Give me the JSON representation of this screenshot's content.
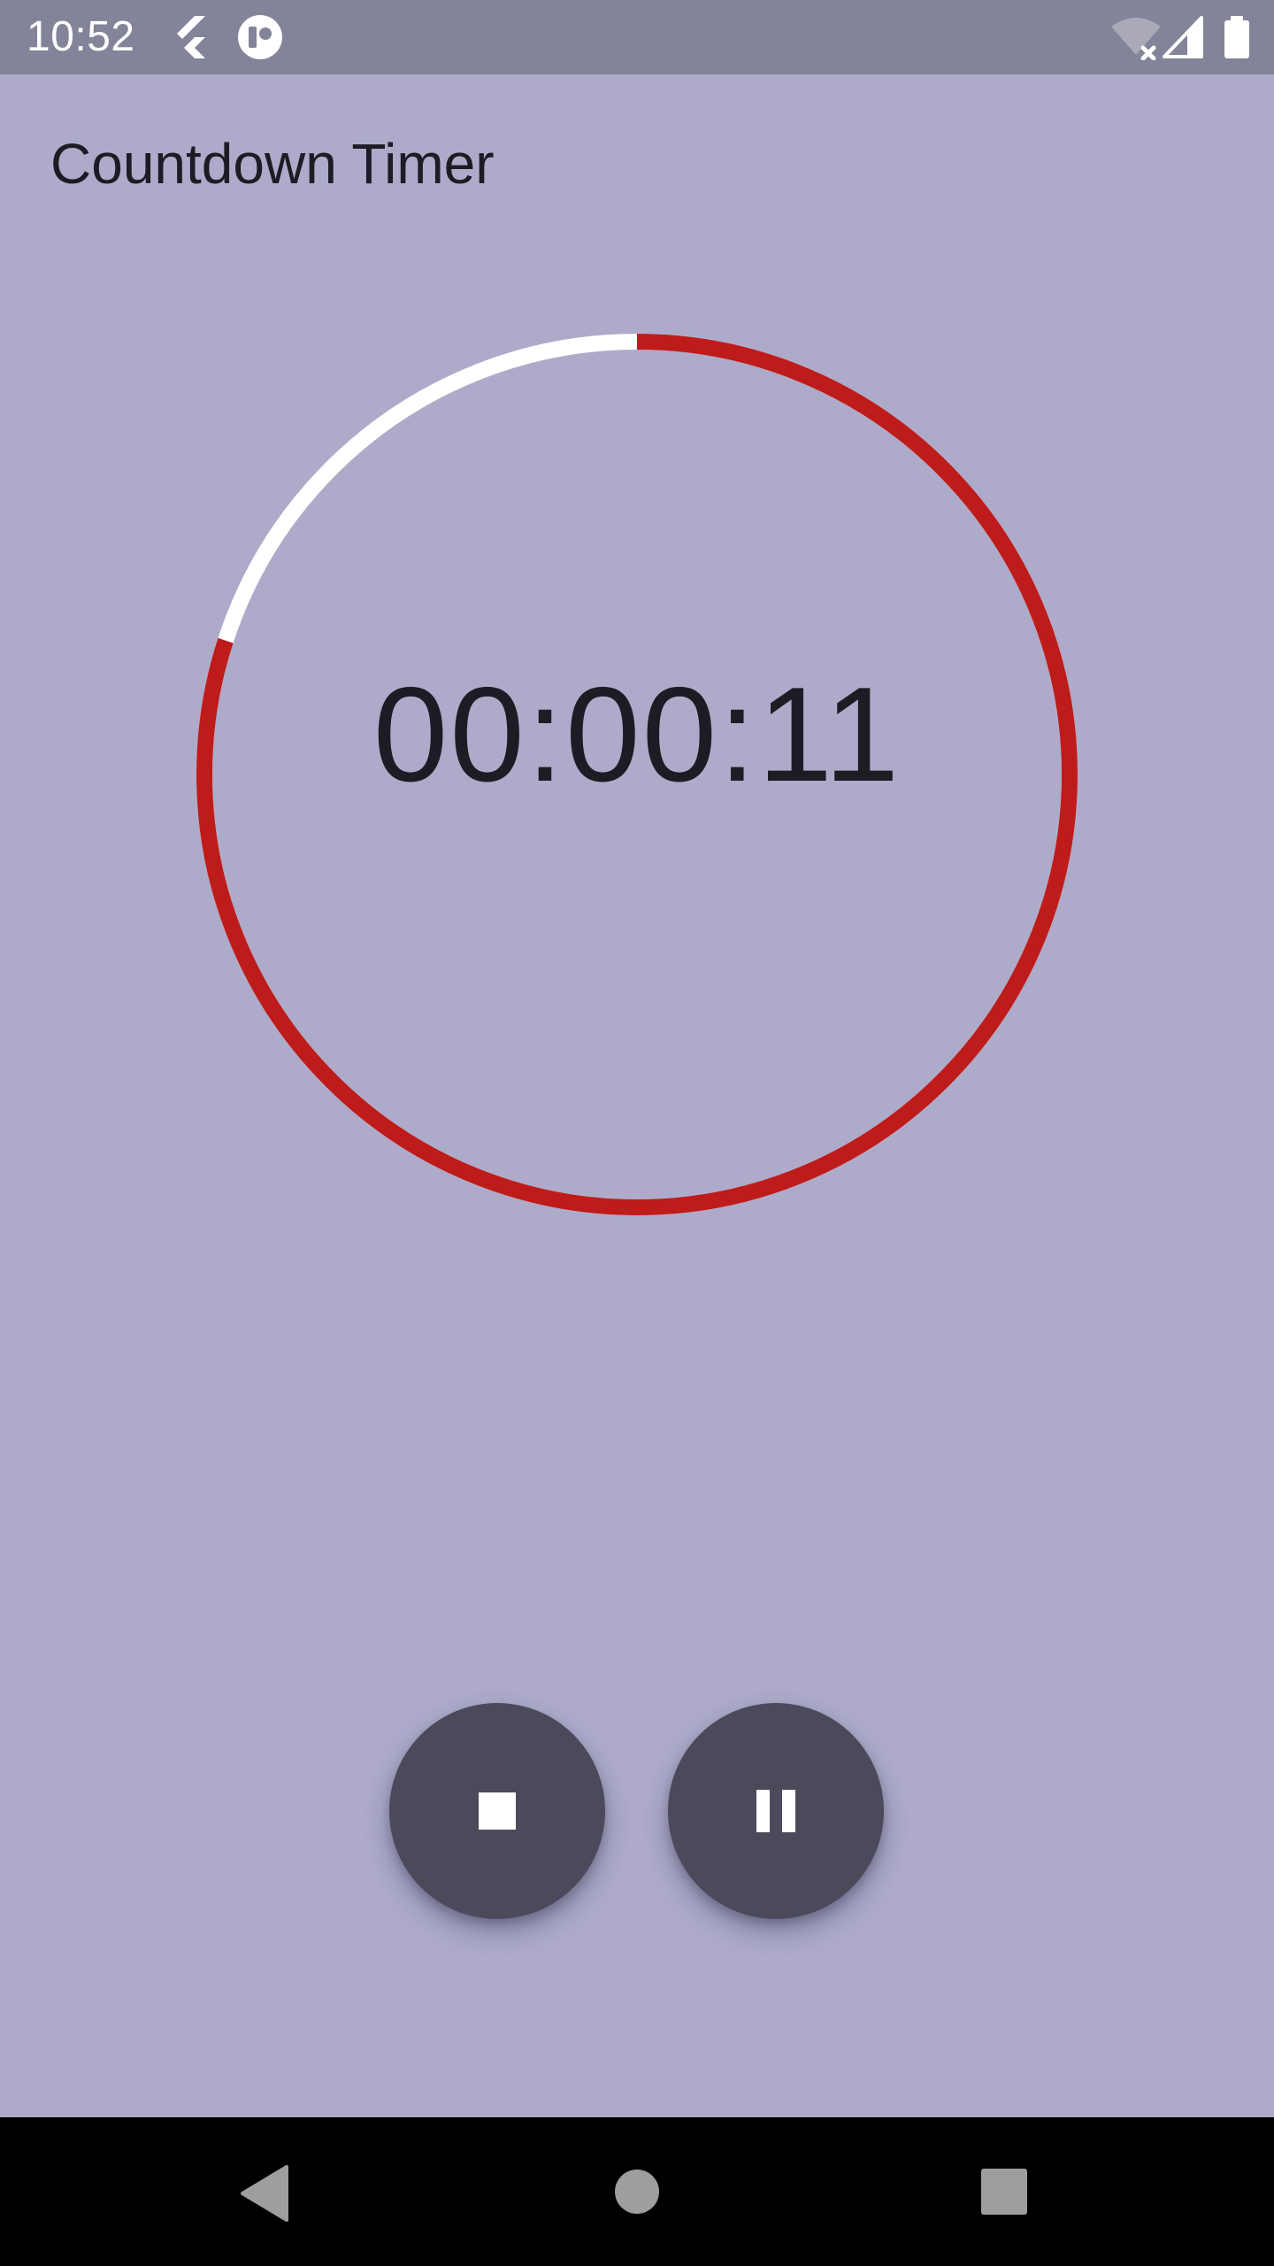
{
  "status_bar": {
    "time": "10:52",
    "left_icons": [
      "flutter-icon",
      "notification-app-icon"
    ],
    "right_icons": [
      "wifi-off-icon",
      "cell-signal-icon",
      "battery-icon"
    ]
  },
  "app_bar": {
    "title": "Countdown Timer"
  },
  "timer": {
    "display": "00:00:11",
    "remaining_fraction": 0.8,
    "colors": {
      "remaining": "#be1b1b",
      "elapsed": "#ffffff"
    }
  },
  "controls": {
    "stop_icon": "stop-icon",
    "pause_icon": "pause-icon",
    "fab_color": "#4b4a5b"
  },
  "nav_bar": {
    "buttons": [
      "back-icon",
      "home-icon",
      "recents-icon"
    ]
  },
  "colors": {
    "background": "#adabc9",
    "status_bar": "#838399",
    "text": "#1d1b24"
  }
}
